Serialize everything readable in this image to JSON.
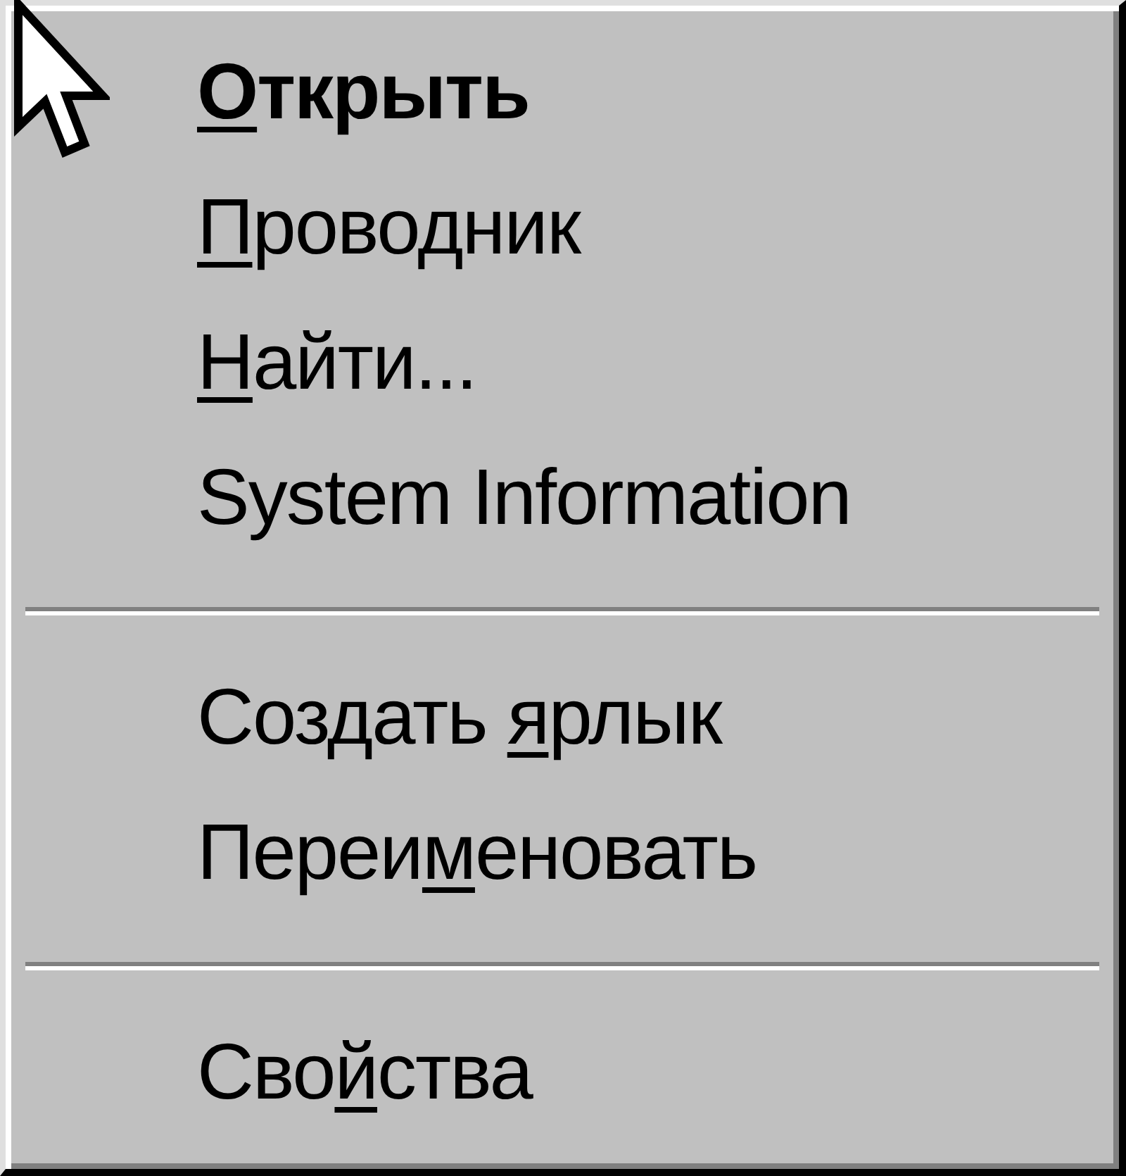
{
  "menu": {
    "groups": [
      {
        "items": [
          {
            "default": true,
            "parts": [
              {
                "text": "О",
                "underlined": true
              },
              {
                "text": "ткрыть",
                "underlined": false
              }
            ]
          },
          {
            "default": false,
            "parts": [
              {
                "text": "П",
                "underlined": true
              },
              {
                "text": "роводник",
                "underlined": false
              }
            ]
          },
          {
            "default": false,
            "parts": [
              {
                "text": "Н",
                "underlined": true
              },
              {
                "text": "айти...",
                "underlined": false
              }
            ]
          },
          {
            "default": false,
            "parts": [
              {
                "text": "System Information",
                "underlined": false
              }
            ]
          }
        ]
      },
      {
        "items": [
          {
            "default": false,
            "parts": [
              {
                "text": "Создать ",
                "underlined": false
              },
              {
                "text": "я",
                "underlined": true
              },
              {
                "text": "рлык",
                "underlined": false
              }
            ]
          },
          {
            "default": false,
            "parts": [
              {
                "text": "Переи",
                "underlined": false
              },
              {
                "text": "м",
                "underlined": true
              },
              {
                "text": "еновать",
                "underlined": false
              }
            ]
          }
        ]
      },
      {
        "items": [
          {
            "default": false,
            "parts": [
              {
                "text": "Сво",
                "underlined": false
              },
              {
                "text": "й",
                "underlined": true
              },
              {
                "text": "ства",
                "underlined": false
              }
            ]
          }
        ]
      }
    ]
  }
}
